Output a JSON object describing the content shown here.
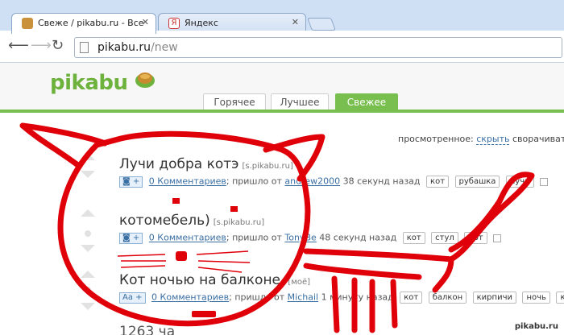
{
  "browser": {
    "tabs": [
      {
        "title": "Свеже / pikabu.ru - Все",
        "favicon": "pikabu-bun-icon",
        "active": true
      },
      {
        "title": "Яндекс",
        "favicon": "yandex-icon",
        "active": false
      }
    ],
    "url_host": "pikabu.ru",
    "url_path": "/new"
  },
  "site": {
    "logo": "pikabu",
    "nav": [
      {
        "label": "Горячее",
        "active": false
      },
      {
        "label": "Лучшее",
        "active": false
      },
      {
        "label": "Свежее",
        "active": true
      }
    ],
    "accent": "#79bf4f"
  },
  "feed": {
    "viewed_label": "просмотренное:",
    "viewed_hide": "скрыть",
    "viewed_collapse": "сворачивать",
    "posts": [
      {
        "title": "Лучи добра котэ",
        "domain": "[s.pikabu.ru]",
        "badge": "+",
        "comments": "0 Комментариев",
        "sent_by": "; пришло от",
        "author": "andrew2000",
        "time": "38 секунд назад",
        "tags": [
          "кот",
          "рубашка",
          "лучи"
        ]
      },
      {
        "title": "котомебель)",
        "domain": "[s.pikabu.ru]",
        "badge": "+",
        "comments": "0 Комментариев",
        "sent_by": "; пришло от",
        "author": "TonyBe",
        "time": "48 секунд назад",
        "tags": [
          "кот",
          "стул",
          "арт"
        ]
      },
      {
        "title": "Кот ночью на балконе.",
        "domain": "[моё]",
        "badge": "Aa +",
        "comments": "0 Комментариев",
        "sent_by": "; пришло от",
        "author": "Michail",
        "time": "1 минуту назад",
        "tags": [
          "кот",
          "балкон",
          "кирпичи",
          "ночь",
          "кот"
        ]
      },
      {
        "title": "1263 ча",
        "domain": "",
        "badge": "",
        "comments": "",
        "sent_by": "",
        "author": "",
        "time": "",
        "tags": []
      }
    ]
  },
  "watermark": "pikabu.ru"
}
